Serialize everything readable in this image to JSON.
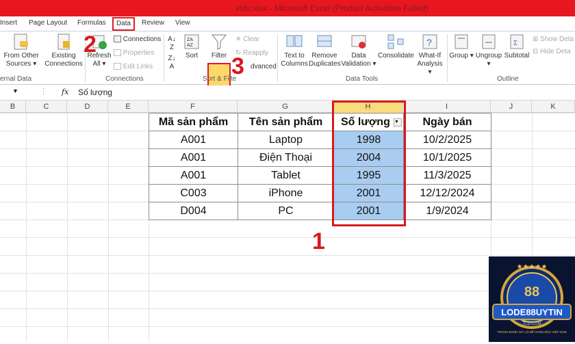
{
  "window": {
    "title": "vidu.xlsx - Microsoft Excel (Product Activation Failed)"
  },
  "menu": {
    "tabs": [
      "Insert",
      "Page Layout",
      "Formulas",
      "Data",
      "Review",
      "View"
    ],
    "active": "Data"
  },
  "ribbon": {
    "get_external": {
      "from_other": "From Other",
      "sources": "Sources",
      "existing": "Existing",
      "connections_btn": "Connections",
      "label": "ernal Data"
    },
    "connections": {
      "refresh": "Refresh",
      "all": "All",
      "connections": "Connections",
      "properties": "Properties",
      "edit_links": "Edit Links",
      "label": "Connections"
    },
    "sort_filter": {
      "sort": "Sort",
      "filter": "Filter",
      "clear": "Clear",
      "reapply": "Reapply",
      "advanced": "dvanced",
      "label": "Sort & Filte"
    },
    "data_tools": {
      "text_to": "Text to",
      "columns": "Columns",
      "remove": "Remove",
      "duplicates": "Duplicates",
      "data": "Data",
      "validation": "Validation",
      "consolidate": "Consolidate",
      "whatif": "What-If",
      "analysis": "Analysis",
      "label": "Data Tools"
    },
    "outline": {
      "group": "Group",
      "ungroup": "Ungroup",
      "subtotal": "Subtotal",
      "show_detail": "Show Deta",
      "hide_detail": "Hide Deta",
      "label": "Outline"
    }
  },
  "formula_bar": {
    "fx": "fx",
    "content": "Số lượng"
  },
  "columns": [
    "B",
    "C",
    "D",
    "E",
    "F",
    "G",
    "H",
    "I",
    "J",
    "K"
  ],
  "table": {
    "headers": [
      "Mã sản phẩm",
      "Tên sản phẩm",
      "Số lượng",
      "Ngày bán"
    ],
    "rows": [
      [
        "A001",
        "Laptop",
        "1998",
        "10/2/2025"
      ],
      [
        "A001",
        "Điện Thoại",
        "2004",
        "10/1/2025"
      ],
      [
        "A001",
        "Tablet",
        "1995",
        "11/3/2025"
      ],
      [
        "C003",
        "iPhone",
        "2001",
        "12/12/2024"
      ],
      [
        "D004",
        "PC",
        "2001",
        "1/9/2024"
      ]
    ]
  },
  "annotations": {
    "step1": "1",
    "step2": "2",
    "step3": "3"
  },
  "colors": {
    "title_bar": "#e7161f",
    "annotation": "#d71920",
    "selection": "#a9cdf0",
    "filter_highlight": "#fcd86b"
  },
  "logo": {
    "brand": "LODE88UYTIN",
    "sub": "TLD.COM",
    "tagline": "TRANG ĐÁNH GIÁ LÔ ĐỀ HÀNG ĐẦU VIỆT NAM"
  }
}
